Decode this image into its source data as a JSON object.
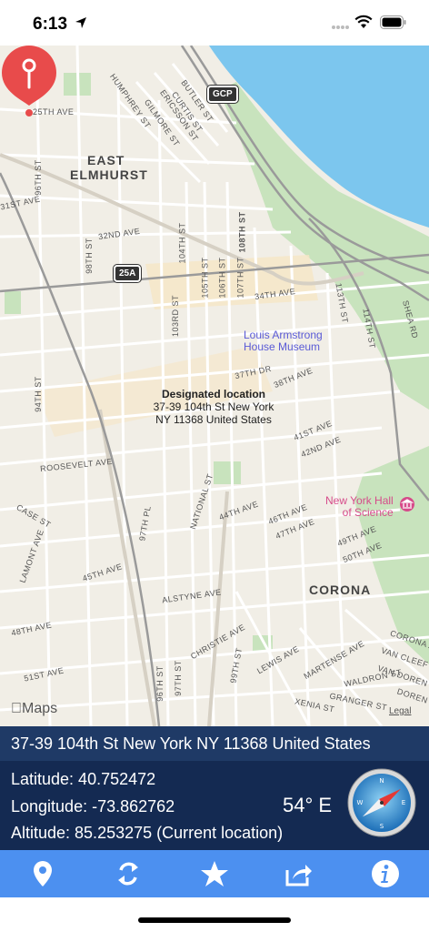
{
  "status": {
    "time": "6:13"
  },
  "map": {
    "area_labels": [
      {
        "id": "east-elmhurst-1",
        "text": "EAST"
      },
      {
        "id": "east-elmhurst-2",
        "text": "ELMHURST"
      },
      {
        "id": "corona",
        "text": "CORONA"
      }
    ],
    "street_labels": [
      "25TH AVE",
      "HUMPHREY ST",
      "GILMORE ST",
      "ERICSSON ST",
      "CURTIS ST",
      "BUTLER ST",
      "32ND AVE",
      "98TH ST",
      "104TH ST",
      "105TH ST",
      "106TH ST",
      "107TH ST",
      "108TH ST",
      "34TH AVE",
      "103RD ST",
      "37TH DR",
      "38TH AVE",
      "94TH ST",
      "41ST AVE",
      "42ND AVE",
      "ROOSEVELT AVE",
      "NATIONAL ST",
      "97TH PL",
      "44TH AVE",
      "46TH AVE",
      "47TH AVE",
      "49TH AVE",
      "50TH AVE",
      "CASE ST",
      "LAMONT AVE",
      "45TH AVE",
      "ALSTYNE AVE",
      "48TH AVE",
      "CHRISTIE AVE",
      "LEWIS AVE",
      "51ST AVE",
      "96TH ST",
      "97TH ST",
      "99TH ST",
      "MARTENSE AVE",
      "WALDRON ST",
      "XENIA ST",
      "GRANGER ST",
      "CORONA AVE",
      "VAN CLEEF ST",
      "VAN DOREN ST",
      "DOREN ST",
      "113TH ST",
      "114TH ST",
      "SHEA RD",
      "96TH ST",
      "31ST AVE"
    ],
    "shields": [
      {
        "id": "gcp",
        "text": "GCP"
      },
      {
        "id": "25a",
        "text": "25A"
      }
    ],
    "pois": [
      {
        "id": "louis-armstrong",
        "line1": "Louis Armstrong",
        "line2": "House Museum",
        "color": "#5a5ad6"
      },
      {
        "id": "ny-hall-of-science",
        "line1": "New York Hall",
        "line2": "of Science",
        "color": "#d64b8a"
      }
    ],
    "pin": {
      "title": "Designated location",
      "line1": "37-39 104th St New York",
      "line2": "NY 11368 United States",
      "color": "#e84b4b"
    },
    "logo": "Maps",
    "legal": "Legal"
  },
  "address": "37-39 104th St New York NY 11368 United States",
  "info": {
    "latitude": "Latitude: 40.752472",
    "longitude": "Longitude: -73.862762",
    "altitude": "Altitude: 85.253275 (Current location)",
    "heading": "54° E"
  },
  "toolbar": {
    "buttons": [
      {
        "id": "location",
        "icon": "map-pin-icon"
      },
      {
        "id": "refresh",
        "icon": "refresh-icon"
      },
      {
        "id": "favorite",
        "icon": "star-icon"
      },
      {
        "id": "share",
        "icon": "share-icon"
      },
      {
        "id": "info",
        "icon": "info-icon"
      }
    ]
  },
  "colors": {
    "toolbar": "#4c90f0",
    "info_panel": "#142a52",
    "address_bar": "#1f3a66",
    "water": "#7cc6ee",
    "park": "#c8e3bd"
  }
}
